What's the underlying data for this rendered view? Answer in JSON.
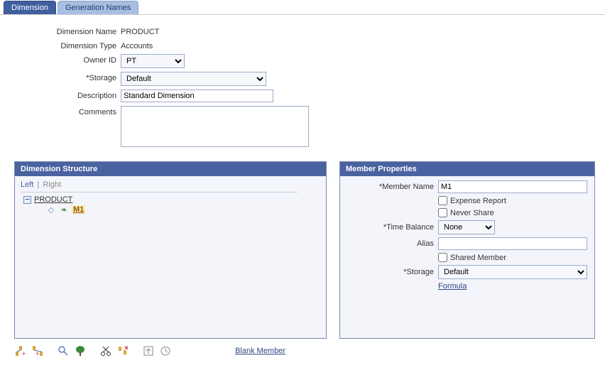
{
  "tabs": {
    "dimension": "Dimension",
    "generation_names": "Generation Names"
  },
  "form": {
    "dimension_name_label": "Dimension Name",
    "dimension_name_value": "PRODUCT",
    "dimension_type_label": "Dimension Type",
    "dimension_type_value": "Accounts",
    "owner_id_label": "Owner ID",
    "owner_id_value": "PT",
    "storage_label": "*Storage",
    "storage_value": "Default",
    "description_label": "Description",
    "description_value": "Standard Dimension",
    "comments_label": "Comments",
    "comments_value": ""
  },
  "structure_panel": {
    "title": "Dimension Structure",
    "left_link": "Left",
    "right_link": "Right",
    "root_node": "PRODUCT",
    "child_node": "M1"
  },
  "member_panel": {
    "title": "Member Properties",
    "member_name_label": "*Member Name",
    "member_name_value": "M1",
    "expense_report_label": "Expense Report",
    "never_share_label": "Never Share",
    "time_balance_label": "*Time Balance",
    "time_balance_value": "None",
    "alias_label": "Alias",
    "alias_value": "",
    "shared_member_label": "Shared Member",
    "storage_label": "*Storage",
    "storage_value": "Default",
    "formula_link": "Formula"
  },
  "footer": {
    "blank_member": "Blank Member"
  }
}
